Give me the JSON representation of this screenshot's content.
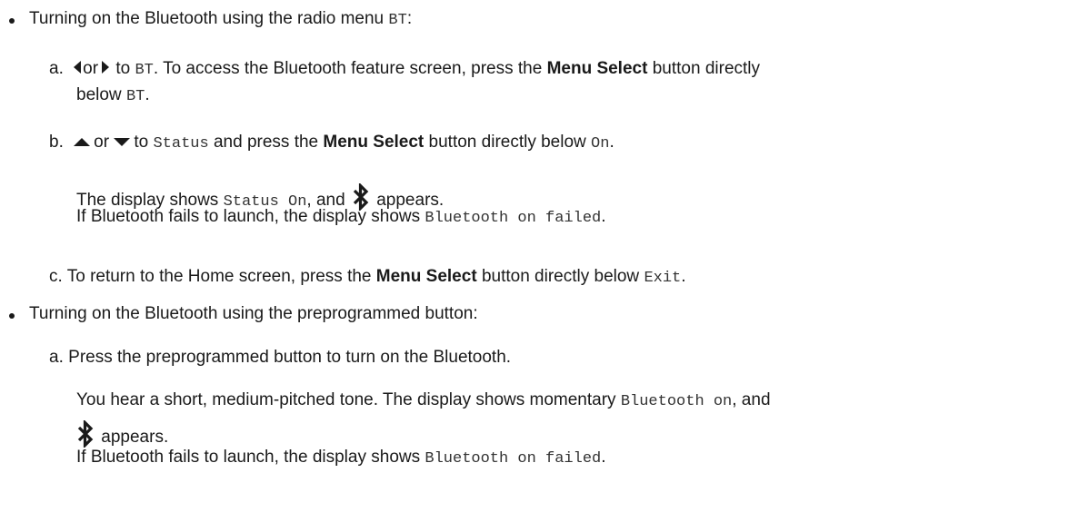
{
  "section1": {
    "heading": "Turning on the Bluetooth using the radio menu",
    "heading_code": "BT",
    "heading_end": ":",
    "step_a": {
      "marker": "a.",
      "or": "or",
      "to": "to",
      "code1": "BT",
      "text1": ". To access the Bluetooth feature screen, press the",
      "bold": "Menu Select",
      "text2": "button directly",
      "text3": "below",
      "code2": "BT",
      "end": "."
    },
    "step_b": {
      "marker": "b.",
      "or": "or",
      "to": "to",
      "code1": "Status",
      "text1": "and press the",
      "bold": "Menu Select",
      "text2": "button directly below",
      "code2": "On",
      "end": ".",
      "display_text": "The display shows",
      "display_code": "Status On",
      "display_and": ", and",
      "appears": "appears.",
      "fail_text": "If Bluetooth fails to launch, the display shows",
      "fail_code": "Bluetooth on failed",
      "fail_end": "."
    },
    "step_c": {
      "marker": "c.",
      "text1": "To return to the Home screen, press the",
      "bold": "Menu Select",
      "text2": "button directly below",
      "code": "Exit",
      "end": "."
    }
  },
  "section2": {
    "heading": "Turning on the Bluetooth using the preprogrammed button:",
    "step_a": {
      "marker": "a.",
      "text": "Press the preprogrammed button to turn on the Bluetooth.",
      "tone_text": "You hear a short, medium-pitched tone. The display shows momentary",
      "tone_code": "Bluetooth on",
      "tone_and": ", and",
      "appears": "appears.",
      "fail_text": "If Bluetooth fails to launch, the display shows",
      "fail_code": "Bluetooth on failed",
      "fail_end": "."
    }
  },
  "icons": {
    "bullet": "bullet-dot",
    "left": "left-arrow-icon",
    "right": "right-arrow-icon",
    "up": "up-arrow-icon",
    "down": "down-arrow-icon",
    "bluetooth": "bluetooth-icon"
  }
}
